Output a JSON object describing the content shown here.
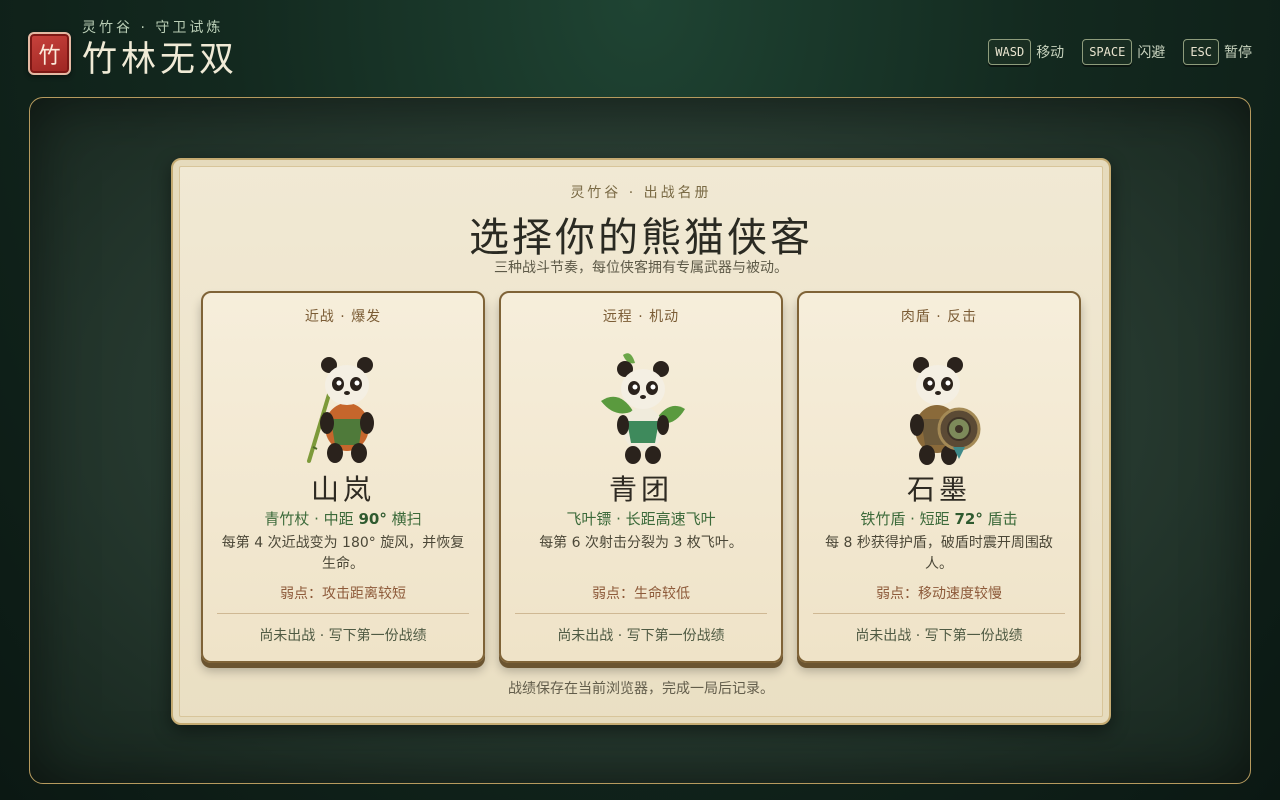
{
  "header": {
    "seal_glyph": "竹",
    "subtitle": "灵竹谷 · 守卫试炼",
    "title": "竹林无双"
  },
  "controls": [
    {
      "key": "WASD",
      "label": "移动"
    },
    {
      "key": "SPACE",
      "label": "闪避"
    },
    {
      "key": "ESC",
      "label": "暂停"
    }
  ],
  "panel": {
    "kicker": "灵竹谷 · 出战名册",
    "title": "选择你的熊猫侠客",
    "description": "三种战斗节奏，每位侠客拥有专属武器与被动。",
    "footer": "战绩保存在当前浏览器，完成一局后记录。"
  },
  "cards": [
    {
      "tag": "近战 · 爆发",
      "name": "山岚",
      "weapon_prefix": "青竹杖 · 中距 ",
      "weapon_value": "90°",
      "weapon_suffix": " 横扫",
      "skill": "每第 4 次近战变为 180° 旋风，并恢复生命。",
      "weakness": "弱点：攻击距离较短",
      "record": "尚未出战 · 写下第一份战绩",
      "icon": "panda-staff-icon"
    },
    {
      "tag": "远程 · 机动",
      "name": "青团",
      "weapon_prefix": "飞叶镖 · 长距高速飞叶",
      "weapon_value": "",
      "weapon_suffix": "",
      "skill": "每第 6 次射击分裂为 3 枚飞叶。",
      "weakness": "弱点：生命较低",
      "record": "尚未出战 · 写下第一份战绩",
      "icon": "panda-leaf-icon"
    },
    {
      "tag": "肉盾 · 反击",
      "name": "石墨",
      "weapon_prefix": "铁竹盾 · 短距 ",
      "weapon_value": "72°",
      "weapon_suffix": " 盾击",
      "skill": "每 8 秒获得护盾，破盾时震开周围敌人。",
      "weakness": "弱点：移动速度较慢",
      "record": "尚未出战 · 写下第一份战绩",
      "icon": "panda-shield-icon"
    }
  ],
  "colors": {
    "background": "#13291f",
    "panel": "#f1e9d4",
    "accent_gold": "#b69a5e",
    "seal_red": "#b83530",
    "weapon_green": "#3c6a3a",
    "weakness_brown": "#8d5a3a"
  }
}
